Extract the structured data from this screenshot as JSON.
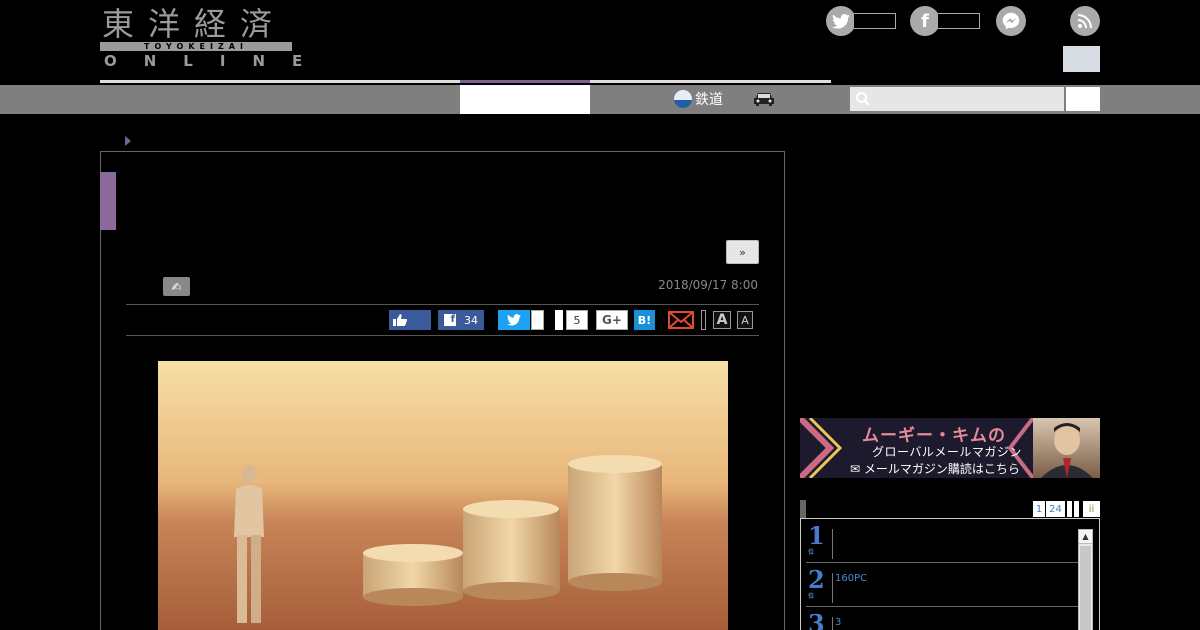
{
  "header": {
    "logo": {
      "kanji": "東洋経済",
      "romaji": "TOYOKEIZAI",
      "online": "ONLINE"
    },
    "social_icons": [
      "twitter-icon",
      "facebook-icon",
      "messenger-icon",
      "rss-icon"
    ]
  },
  "nav": {
    "items": [
      {
        "label": "鉄道",
        "icon": "train-icon"
      },
      {
        "label": "",
        "icon": "car-icon"
      }
    ],
    "search": {
      "placeholder": ""
    }
  },
  "article": {
    "next_label": "»",
    "date": "2018/09/17 8:00",
    "share": {
      "facebook_count": "34",
      "pocket_count": "5",
      "gplus_label": "G+",
      "hatena_label": "B!",
      "font_large": "A",
      "font_small": "A"
    },
    "photo_icon": "coins-and-figure-photo"
  },
  "sidebar": {
    "banner": {
      "title": "ムーギー・キムの",
      "subtitle": "グローバルメールマガジン",
      "cta": "✉ メールマガジン購読はこちら"
    },
    "ranking": {
      "tabs": [
        "1",
        "24",
        "",
        "",
        "ii"
      ],
      "items": [
        {
          "rank": "1",
          "suffix": "位",
          "text": ""
        },
        {
          "rank": "2",
          "suffix": "位",
          "text": "160PC"
        },
        {
          "rank": "3",
          "suffix": "位",
          "text": "3"
        }
      ]
    }
  },
  "colors": {
    "accent_purple": "#7b5f8e",
    "nav_gray": "#7f7f7f",
    "facebook_blue": "#3b5a9a",
    "twitter_blue": "#1da1f2",
    "rank_blue": "#4a7ac8"
  }
}
